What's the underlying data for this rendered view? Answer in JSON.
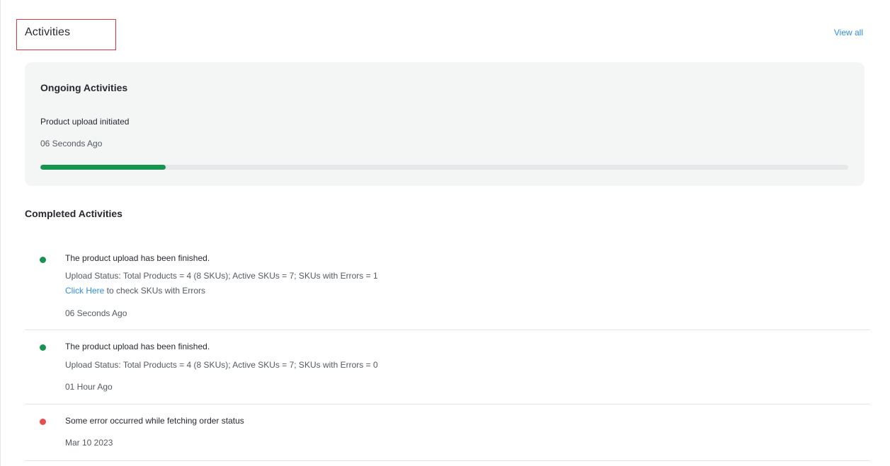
{
  "header": {
    "title": "Activities",
    "view_all_label": "View all"
  },
  "ongoing": {
    "section_title": "Ongoing Activities",
    "item": {
      "title": "Product upload initiated",
      "time": "06 Seconds Ago",
      "progress_percent": 15.5
    }
  },
  "completed": {
    "section_title": "Completed Activities",
    "items": [
      {
        "status": "success",
        "title": "The product upload has been finished.",
        "detail": "Upload Status: Total Products = 4 (8 SKUs); Active SKUs = 7; SKUs with Errors = 1",
        "link_text": "Click Here",
        "link_suffix": " to check SKUs with Errors",
        "time": "06 Seconds Ago"
      },
      {
        "status": "success",
        "title": "The product upload has been finished.",
        "detail": "Upload Status: Total Products = 4 (8 SKUs); Active SKUs = 7; SKUs with Errors = 0",
        "time": "01 Hour Ago"
      },
      {
        "status": "error",
        "title": "Some error occurred while fetching order status",
        "time": "Mar 10 2023"
      }
    ]
  },
  "colors": {
    "accent_link": "#2d8de8",
    "success": "#16954f",
    "error": "#ec4c4c",
    "highlight_border": "#e0373e",
    "card_background": "#f4f5f5"
  },
  "icons": {
    "success": "green-status-dot-icon",
    "error": "red-status-dot-icon"
  }
}
